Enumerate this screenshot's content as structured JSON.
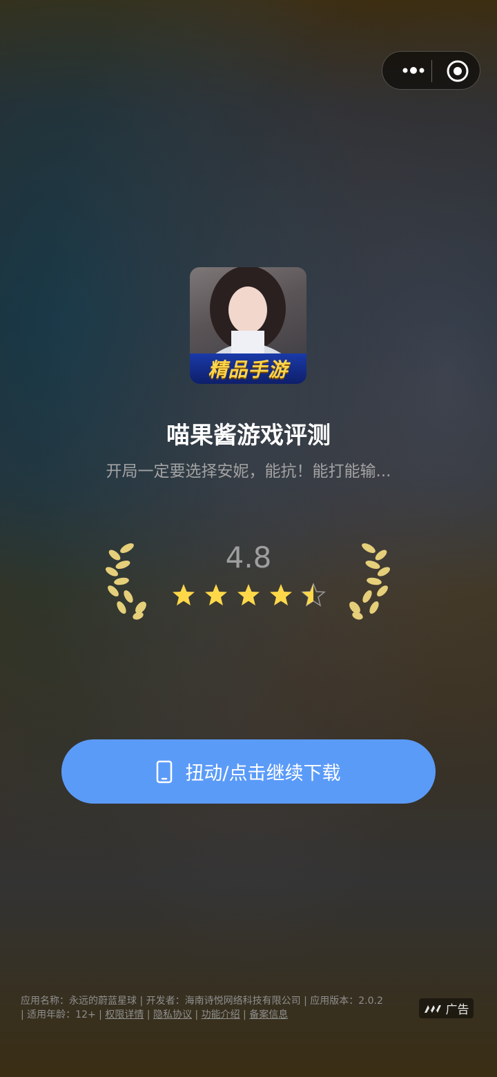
{
  "icons": {
    "more": "more-dots-icon",
    "close": "close-circle-icon",
    "phone": "phone-icon",
    "ad": "ad-logo-icon"
  },
  "colors": {
    "button": "#5b9bf8",
    "star": "#ffd84a",
    "laurel": "#e6cf7a"
  },
  "app": {
    "icon_badge": "精品手游",
    "title": "喵果酱游戏评测",
    "subtitle": "开局一定要选择安妮，能抗！能打能输..."
  },
  "rating": {
    "value": "4.8",
    "stars_filled": 4.5,
    "stars_total": 5
  },
  "download": {
    "label": "扭动/点击继续下载"
  },
  "footer": {
    "line1": "应用名称：永远的蔚蓝星球 | 开发者：海南诗悦网络科技有限公司 | 应用版本：2.0.2",
    "line2_prefix": "| 适用年龄：12+ | ",
    "permissions": "权限详情",
    "sep1": " | ",
    "privacy": "隐私协议",
    "sep2": " | ",
    "features": "功能介绍",
    "sep3": " | ",
    "filing": "备案信息"
  },
  "ad_label": "广告"
}
